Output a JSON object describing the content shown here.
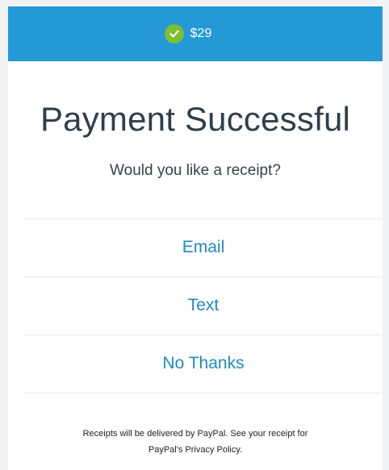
{
  "header": {
    "amount": "$29",
    "status_icon": "checkmark-circle",
    "background": "#2598d6",
    "check_color": "#7cbf2f"
  },
  "main": {
    "title": "Payment Successful",
    "question": "Would you like a receipt?"
  },
  "options": {
    "email": "Email",
    "text": "Text",
    "no_thanks": "No Thanks"
  },
  "footer": {
    "line1": "Receipts will be delivered by PayPal. See your receipt for",
    "line2": "PayPal's Privacy Policy."
  }
}
